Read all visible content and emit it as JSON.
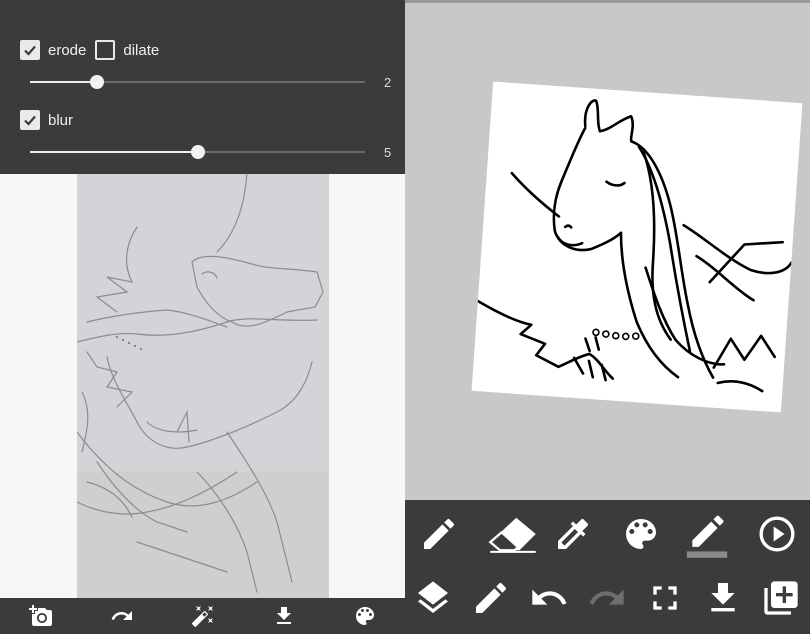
{
  "controls": {
    "erode": {
      "label": "erode",
      "checked": true
    },
    "dilate": {
      "label": "dilate",
      "checked": false
    },
    "blur": {
      "label": "blur",
      "checked": true
    },
    "erode_slider": {
      "value": "2",
      "fraction": 0.2
    },
    "blur_slider": {
      "value": "5",
      "fraction": 0.5
    }
  },
  "left_toolbar": {
    "icons": [
      "add-photo-icon",
      "redo-icon",
      "magic-wand-icon",
      "download-icon",
      "palette-icon"
    ]
  },
  "right_toolbar": {
    "row1": [
      "pencil-icon",
      "eraser-icon",
      "eyedropper-icon",
      "palette-icon",
      "brush-color-icon",
      "play-icon"
    ],
    "row2": [
      "layers-icon",
      "edit-icon",
      "undo-icon",
      "redo-icon",
      "fullscreen-icon",
      "download-icon",
      "add-layer-icon"
    ]
  },
  "colors": {
    "panel_dark": "#3b3b3b",
    "canvas_bg": "#c8c8c8",
    "icon_light": "#ffffff",
    "icon_disabled": "#6e6e6e"
  }
}
